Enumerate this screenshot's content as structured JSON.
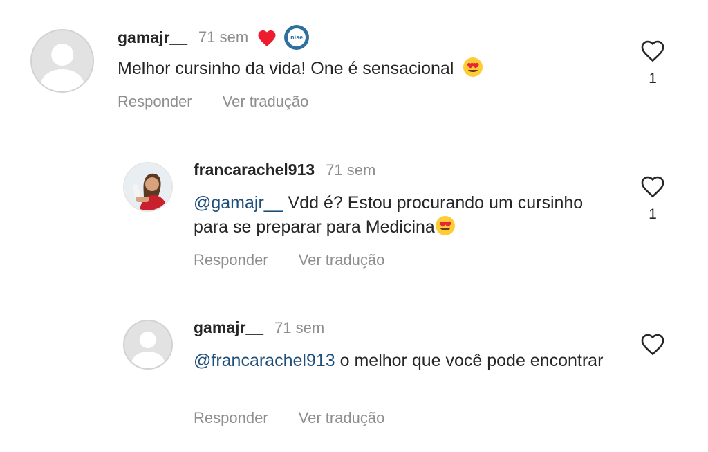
{
  "comments": [
    {
      "username": "gamajr__",
      "time": "71 sem",
      "text": "Melhor cursinho da vida! One é sensacional",
      "reply_label": "Responder",
      "translate_label": "Ver tradução",
      "like_count": "1",
      "badge_text": "nise"
    },
    {
      "username": "francarachel913",
      "time": "71 sem",
      "mention": "@gamajr__",
      "text": " Vdd é? Estou procurando um cursinho para se preparar para Medicina",
      "reply_label": "Responder",
      "translate_label": "Ver tradução",
      "like_count": "1"
    },
    {
      "username": "gamajr__",
      "time": "71 sem",
      "mention": "@francarachel913",
      "text": " o melhor que você pode encontrar",
      "reply_label": "Responder",
      "translate_label": "Ver tradução"
    }
  ],
  "colors": {
    "heart_red": "#ed1c2e",
    "mention_blue": "#1e4f7a",
    "muted_gray": "#8e8e8e"
  },
  "icons": {
    "like": "heart-outline-icon",
    "creator_liked": "red-heart-icon",
    "emoji": "heart-eyes-emoji"
  }
}
